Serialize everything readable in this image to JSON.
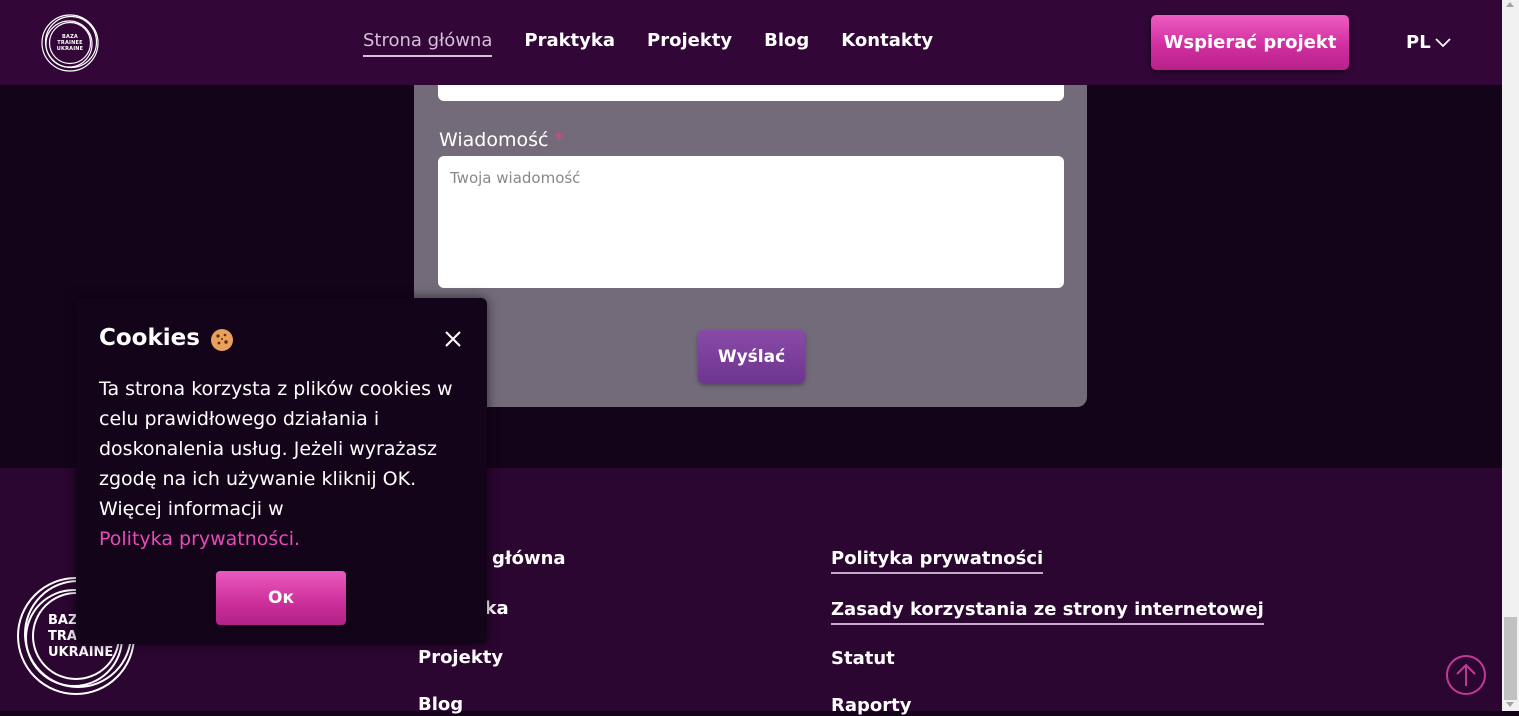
{
  "header": {
    "logo_lines": [
      "BAZA",
      "TRAINEE",
      "UKRAINE"
    ],
    "nav": [
      {
        "label": "Strona główna",
        "active": true
      },
      {
        "label": "Praktyka"
      },
      {
        "label": "Projekty"
      },
      {
        "label": "Blog"
      },
      {
        "label": "Kontakty"
      }
    ],
    "support_label": "Wspierać projekt",
    "lang": "PL"
  },
  "form": {
    "prev_field_placeholder": "",
    "message_label": "Wiadomość",
    "required_mark": "*",
    "message_placeholder": "Twoja wiadomość",
    "send_label": "Wyślać"
  },
  "footer": {
    "logo_lines": [
      "BAZA",
      "TRAINEE",
      "UKRAINE"
    ],
    "col1": [
      "Strona główna",
      "Praktyka",
      "Projekty",
      "Blog"
    ],
    "col2": [
      "Polityka prywatności",
      "Zasady korzystania ze strony internetowej",
      "Statut",
      "Raporty"
    ]
  },
  "cookie": {
    "title": "Cookies",
    "text": "Ta strona korzysta z plików cookies w celu prawidłowego działania i doskonalenia usług. Jeżeli wyrażasz zgodę na ich używanie kliknij OK. Więcej informacji w",
    "link": "Polityka prywatności.",
    "ok_label": "Ок"
  },
  "colors": {
    "header_bg": "#320738",
    "page_bg": "#14041a",
    "footer_bg": "#2b0630",
    "accent_pink": "#e74bb8",
    "form_card": "#736b7a"
  },
  "icons": [
    "logo-icon",
    "chevron-down-icon",
    "cookie-icon",
    "close-icon",
    "arrow-up-icon"
  ]
}
